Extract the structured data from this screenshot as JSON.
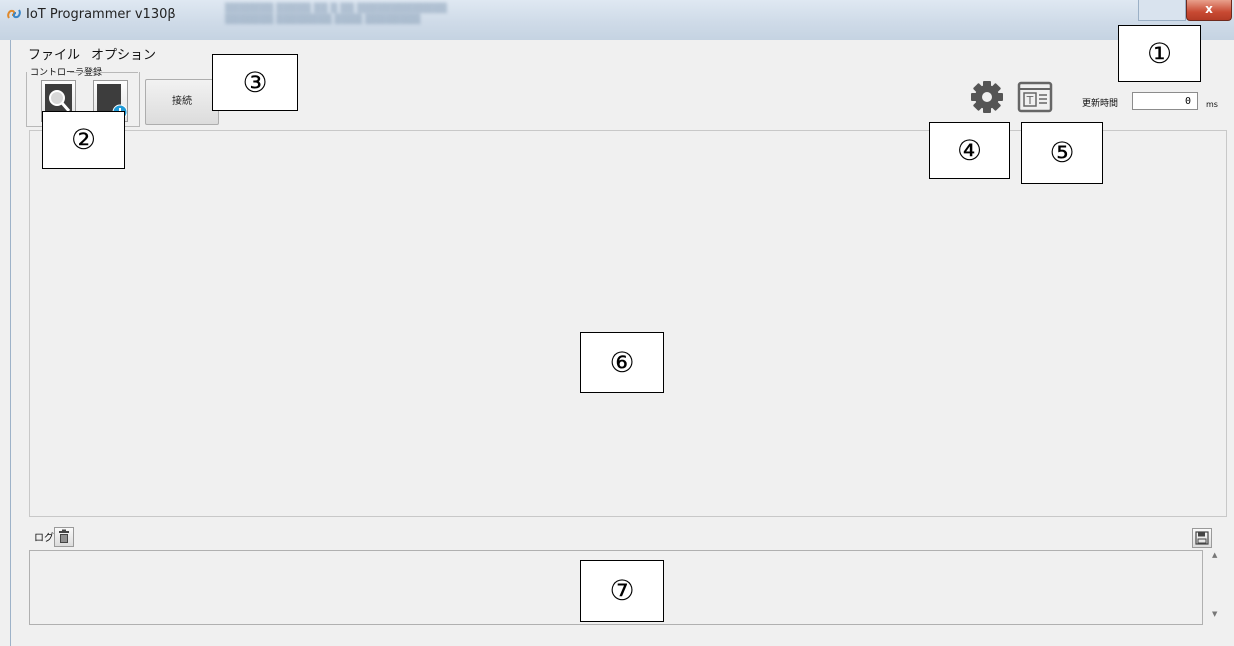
{
  "window": {
    "title": "IoT Programmer v130β"
  },
  "menu": {
    "file": "ファイル",
    "options": "オプション"
  },
  "toolbar": {
    "controller_group_label": "コントローラ登録",
    "connect_label": "接続",
    "update_interval_label": "更新時間",
    "update_interval_value": "0",
    "update_interval_unit": "ms"
  },
  "log": {
    "label": "ログ"
  },
  "callouts": {
    "c1": "①",
    "c2": "②",
    "c3": "③",
    "c4": "④",
    "c5": "⑤",
    "c6": "⑥",
    "c7": "⑦"
  },
  "icons": {
    "search_controller": "magnifier-icon",
    "add_controller": "add-device-icon",
    "settings": "gear-icon",
    "text_view": "text-panel-icon",
    "clear_log": "trash-icon",
    "save_log": "floppy-disk-icon",
    "close": "close-icon"
  },
  "colors": {
    "titlebar": "#cfdbe8",
    "close_button": "#c84a33",
    "add_badge": "#1f9ad6",
    "icon_gray": "#555555"
  }
}
